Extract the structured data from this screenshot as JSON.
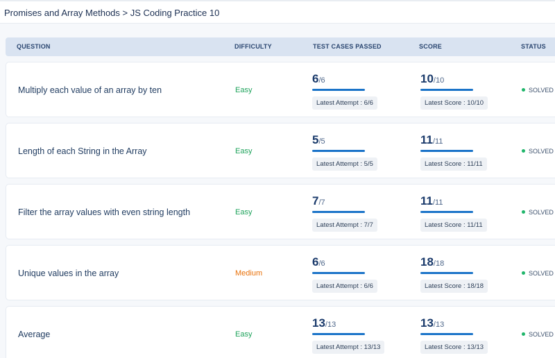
{
  "breadcrumb": "Promises and Array Methods > JS Coding Practice 10",
  "table": {
    "headers": {
      "question": "QUESTION",
      "difficulty": "DIFFICULTY",
      "tests": "TEST CASES PASSED",
      "score": "SCORE",
      "status": "STATUS"
    },
    "rows": [
      {
        "question": "Multiply each value of an array by ten",
        "difficulty": "Easy",
        "tests_passed": "6",
        "tests_total": "/6",
        "tests_chip": "Latest Attempt : 6/6",
        "score": "10",
        "score_total": "/10",
        "score_chip": "Latest Score : 10/10",
        "status": "SOLVED"
      },
      {
        "question": "Length of each String in the Array",
        "difficulty": "Easy",
        "tests_passed": "5",
        "tests_total": "/5",
        "tests_chip": "Latest Attempt : 5/5",
        "score": "11",
        "score_total": "/11",
        "score_chip": "Latest Score : 11/11",
        "status": "SOLVED"
      },
      {
        "question": "Filter the array values with even string length",
        "difficulty": "Easy",
        "tests_passed": "7",
        "tests_total": "/7",
        "tests_chip": "Latest Attempt : 7/7",
        "score": "11",
        "score_total": "/11",
        "score_chip": "Latest Score : 11/11",
        "status": "SOLVED"
      },
      {
        "question": "Unique values in the array",
        "difficulty": "Medium",
        "tests_passed": "6",
        "tests_total": "/6",
        "tests_chip": "Latest Attempt : 6/6",
        "score": "18",
        "score_total": "/18",
        "score_chip": "Latest Score : 18/18",
        "status": "SOLVED"
      },
      {
        "question": "Average",
        "difficulty": "Easy",
        "tests_passed": "13",
        "tests_total": "/13",
        "tests_chip": "Latest Attempt : 13/13",
        "score": "13",
        "score_total": "/13",
        "score_chip": "Latest Score : 13/13",
        "status": "SOLVED"
      }
    ]
  },
  "colors": {
    "easy": "#1fa35c",
    "medium": "#e8710a",
    "solved_dot": "#1fb56a",
    "progress": "#1a73c8"
  },
  "icons": {
    "status": "solved-dot-icon"
  }
}
